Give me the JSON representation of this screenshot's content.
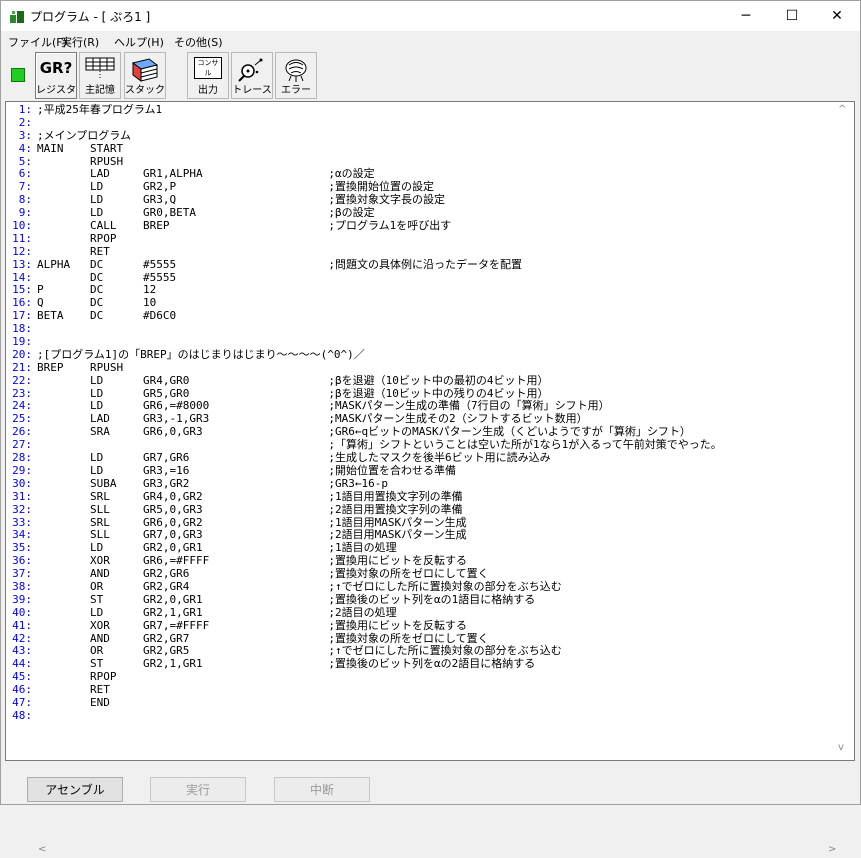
{
  "window": {
    "title": "プログラム - [ ぷろ1 ]"
  },
  "title_buttons": {
    "minimize": "─",
    "maximize": "☐",
    "close": "✕"
  },
  "menu": [
    "ファイル(F)",
    "実行(R)",
    "ヘルプ(H)",
    "その他(S)"
  ],
  "toolbar": {
    "status_color": "#22cc22",
    "buttons": [
      {
        "label": "レジスタ",
        "icon": "register-icon",
        "icon_text": "GR?"
      },
      {
        "label": "主記憶",
        "icon": "memory-grid-icon"
      },
      {
        "label": "スタック",
        "icon": "stack-icon"
      },
      {
        "label": "出力",
        "icon": "console-output-icon",
        "icon_text": "コンサル"
      },
      {
        "label": "トレース",
        "icon": "trace-icon"
      },
      {
        "label": "エラー",
        "icon": "error-bug-icon"
      }
    ]
  },
  "editor": {
    "line_numbers": [
      "1:",
      "2:",
      "3:",
      "4:",
      "5:",
      "6:",
      "7:",
      "8:",
      "9:",
      "10:",
      "11:",
      "12:",
      "13:",
      "14:",
      "15:",
      "16:",
      "17:",
      "18:",
      "19:",
      "20:",
      "21:",
      "22:",
      "23:",
      "24:",
      "25:",
      "26:",
      "27:",
      "28:",
      "29:",
      "30:",
      "31:",
      "32:",
      "33:",
      "34:",
      "35:",
      "36:",
      "37:",
      "38:",
      "39:",
      "40:",
      "41:",
      "42:",
      "43:",
      "44:",
      "45:",
      "46:",
      "47:",
      "48:"
    ],
    "lines": [
      ";平成25年春プログラム1",
      "",
      ";メインプログラム",
      "MAIN    START",
      "        RPUSH",
      "        LAD     GR1,ALPHA                   ;αの設定",
      "        LD      GR2,P                       ;置換開始位置の設定",
      "        LD      GR3,Q                       ;置換対象文字長の設定",
      "        LD      GR0,BETA                    ;βの設定",
      "        CALL    BREP                        ;プログラム1を呼び出す",
      "        RPOP",
      "        RET",
      "ALPHA   DC      #5555                       ;問題文の具体例に沿ったデータを配置",
      "        DC      #5555",
      "P       DC      12",
      "Q       DC      10",
      "BETA    DC      #D6C0",
      "",
      "",
      ";[プログラム1]の「BREP」のはじまりはじまり～～～～(^0^)／",
      "BREP    RPUSH",
      "        LD      GR4,GR0                     ;βを退避（10ビット中の最初の4ビット用）",
      "        LD      GR5,GR0                     ;βを退避（10ビット中の残りの4ビット用）",
      "        LD      GR6,=#8000                  ;MASKパターン生成の準備（7行目の「算術」シフト用）",
      "        LAD     GR3,-1,GR3                  ;MASKパターン生成その2（シフトするビット数用）",
      "        SRA     GR6,0,GR3                   ;GR6←qビットのMASKパターン生成（くどいようですが「算術」シフト）",
      "                                            ;「算術」シフトということは空いた所が1なら1が入るって午前対策でやった。",
      "        LD      GR7,GR6                     ;生成したマスクを後半6ビット用に読み込み",
      "        LD      GR3,=16                     ;開始位置を合わせる準備",
      "        SUBA    GR3,GR2                     ;GR3←16-p",
      "        SRL     GR4,0,GR2                   ;1語目用置換文字列の準備",
      "        SLL     GR5,0,GR3                   ;2語目用置換文字列の準備",
      "        SRL     GR6,0,GR2                   ;1語目用MASKパターン生成",
      "        SLL     GR7,0,GR3                   ;2語目用MASKパターン生成",
      "        LD      GR2,0,GR1                   ;1語目の処理",
      "        XOR     GR6,=#FFFF                  ;置換用にビットを反転する",
      "        AND     GR2,GR6                     ;置換対象の所をゼロにして置く",
      "        OR      GR2,GR4                     ;↑でゼロにした所に置換対象の部分をぶち込む",
      "        ST      GR2,0,GR1                   ;置換後のビット列をαの1語目に格納する",
      "        LD      GR2,1,GR1                   ;2語目の処理",
      "        XOR     GR7,=#FFFF                  ;置換用にビットを反転する",
      "        AND     GR2,GR7                     ;置換対象の所をゼロにして置く",
      "        OR      GR2,GR5                     ;↑でゼロにした所に置換対象の部分をぶち込む",
      "        ST      GR2,1,GR1                   ;置換後のビット列をαの2語目に格納する",
      "        RPOP",
      "        RET",
      "        END",
      ""
    ],
    "line_number_color": "#0000ff"
  },
  "bottom_buttons": [
    {
      "label": "アセンブル",
      "enabled": true
    },
    {
      "label": "実行",
      "enabled": false
    },
    {
      "label": "中断",
      "enabled": false
    }
  ]
}
